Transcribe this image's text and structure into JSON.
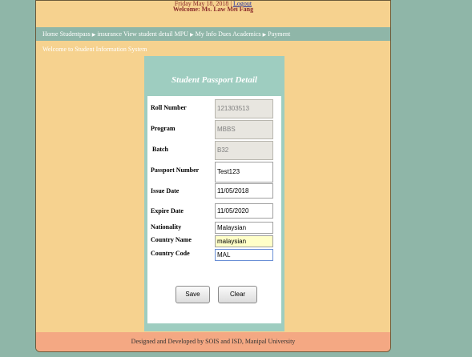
{
  "header": {
    "date": "Friday May 18, 2018 |",
    "logout": "Logout",
    "welcome_user": "Welcome: Ms. Law Mei Fang"
  },
  "nav": {
    "items": [
      "Home",
      "Studentpass",
      "insurance",
      "View student detail",
      "MPU",
      "My Info",
      "Dues",
      "Academics",
      "Payment"
    ]
  },
  "welcome_system": "Welcome to Student Information System",
  "form": {
    "title": "Student Passport Detail",
    "fields": {
      "roll_number": {
        "label": "Roll Number",
        "value": "121303513"
      },
      "program": {
        "label": "Program",
        "value": "MBBS"
      },
      "batch": {
        "label": "Batch",
        "value": "B32"
      },
      "passport_number": {
        "label": "Passport Number",
        "value": "Test123"
      },
      "issue_date": {
        "label": "Issue Date",
        "value": "11/05/2018"
      },
      "expire_date": {
        "label": "Expire Date",
        "value": "11/05/2020"
      },
      "nationality": {
        "label": "Nationality",
        "value": "Malaysian"
      },
      "country_name": {
        "label": "Country Name",
        "value": "malaysian"
      },
      "country_code": {
        "label": "Country Code",
        "value": "MAL"
      }
    },
    "save_label": "Save",
    "clear_label": "Clear"
  },
  "footer": "Designed and Developed by SOIS and ISD, Manipal University",
  "colors": {
    "page_bg": "#f6d28f",
    "teal": "#8fb6a8",
    "panel": "#9ecdc0",
    "footer": "#f4a883"
  }
}
